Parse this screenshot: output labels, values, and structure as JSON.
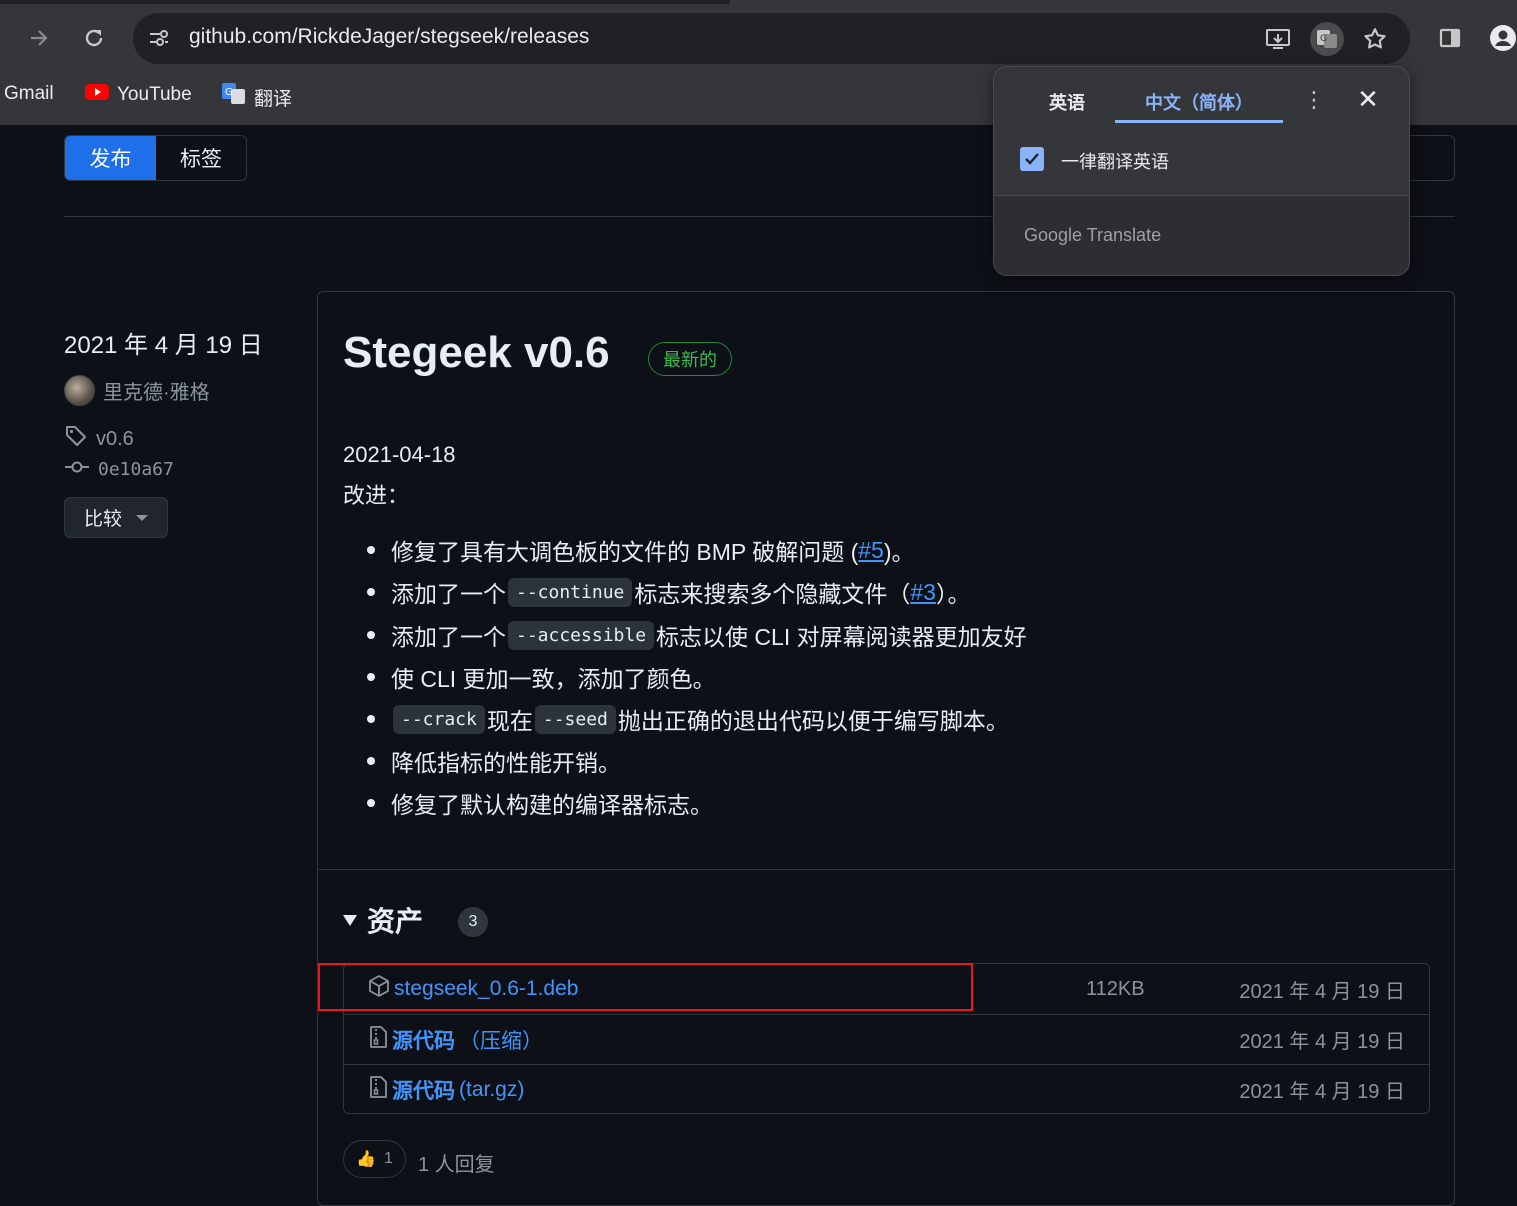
{
  "browser": {
    "url": "github.com/RickdeJager/stegseek/releases",
    "bookmarks": [
      {
        "label": "Gmail"
      },
      {
        "label": "YouTube"
      },
      {
        "label": "翻译"
      }
    ]
  },
  "github": {
    "tabs": {
      "releases": "发布",
      "tags": "标签"
    },
    "sidebar": {
      "date": "2021 年 4 月 19 日",
      "author": "里克德·雅格",
      "tag": "v0.6",
      "commit": "0e10a67",
      "compare_label": "比较"
    },
    "release": {
      "title": "Stegeek v0.6",
      "latest_badge": "最新的",
      "date_line": "2021-04-18",
      "improvements_label": "改进：",
      "bullets": [
        {
          "pre": "修复了具有大调色板的文件的 BMP 破解问题 ( ",
          "link": "#5",
          "post": " )。"
        },
        {
          "pre": "添加了一个",
          "code": "--continue",
          "mid": "标志来搜索多个隐藏文件（",
          "link": "#3",
          "post": "）。"
        },
        {
          "pre": "添加了一个",
          "code": "--accessible",
          "post": "标志以使 CLI 对屏幕阅读器更加友好"
        },
        {
          "text": "使 CLI 更加一致，添加了颜色。"
        },
        {
          "code": "--crack",
          "mid": "现在",
          "code2": "--seed",
          "post": "抛出正确的退出代码以便于编写脚本。"
        },
        {
          "text": "降低指标的性能开销。"
        },
        {
          "text": "修复了默认构建的编译器标志。"
        }
      ],
      "assets": {
        "title": "资产",
        "count": "3",
        "items": [
          {
            "name": "stegseek_0.6-1.deb",
            "size": "112KB",
            "date": "2021 年 4 月 19 日"
          },
          {
            "name": "源代码",
            "suffix": "（压缩）",
            "date": "2021 年 4 月 19 日"
          },
          {
            "name": "源代码",
            "suffix": "(tar.gz)",
            "date": "2021 年 4 月 19 日"
          }
        ]
      },
      "reactions": {
        "emoji": "👍",
        "count": "1",
        "text": "1 人回复"
      }
    }
  },
  "translate_popup": {
    "tab_source": "英语",
    "tab_target": "中文（简体）",
    "always_translate_label": "一律翻译英语",
    "always_translate_checked": true,
    "footer": "Google Translate"
  },
  "colors": {
    "accent": "#1f6feb",
    "link": "#4493f8",
    "latest": "#3fb950",
    "highlight": "#e5191f"
  }
}
